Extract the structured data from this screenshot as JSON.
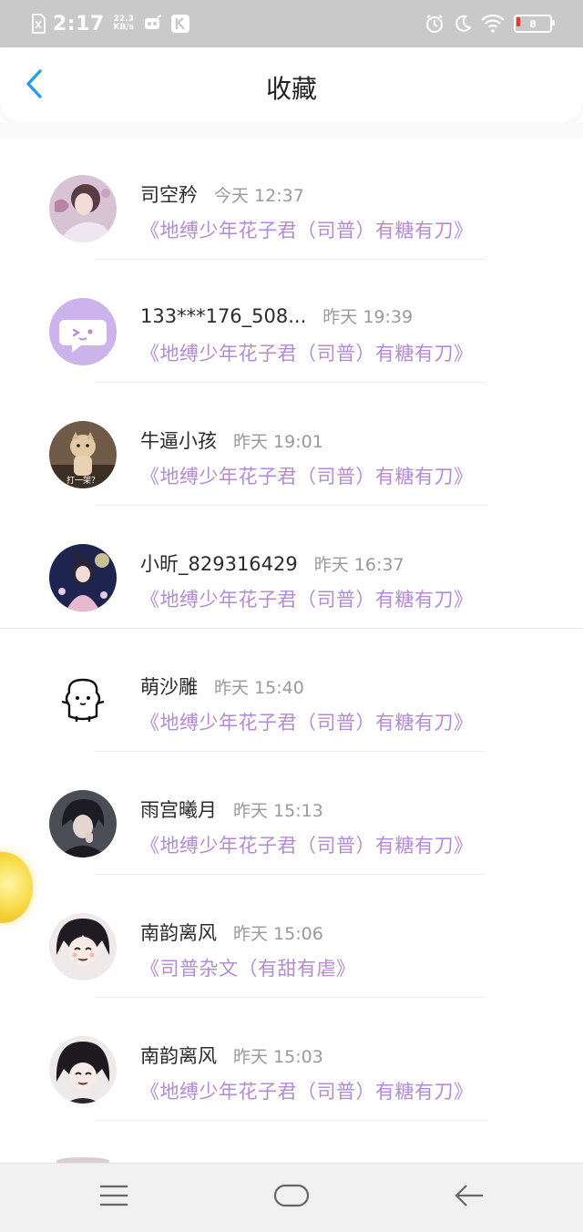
{
  "status_bar": {
    "time": "2:17",
    "speed_value": "22.3",
    "speed_unit": "KB/s",
    "battery_level": "8",
    "icons": [
      "sim-off-icon",
      "kk-app-icon",
      "k-app-icon",
      "alarm-icon",
      "moon-icon",
      "wifi-icon",
      "battery-icon"
    ]
  },
  "header": {
    "title": "收藏",
    "back_icon": "chevron-left-icon"
  },
  "accent_color": "#b58ad4",
  "favorites": [
    {
      "name": "司空矜",
      "time": "今天 12:37",
      "title": "《地缚少年花子君（司普）有糖有刀》"
    },
    {
      "name": "133***176_508...",
      "time": "昨天 19:39",
      "title": "《地缚少年花子君（司普）有糖有刀》"
    },
    {
      "name": "牛逼小孩",
      "time": "昨天 19:01",
      "title": "《地缚少年花子君（司普）有糖有刀》",
      "avatar_caption": "打一架？"
    },
    {
      "name": "小昕_829316429",
      "time": "昨天 16:37",
      "title": "《地缚少年花子君（司普）有糖有刀》"
    },
    {
      "name": "萌沙雕",
      "time": "昨天 15:40",
      "title": "《地缚少年花子君（司普）有糖有刀》"
    },
    {
      "name": "雨宫曦月",
      "time": "昨天 15:13",
      "title": "《地缚少年花子君（司普）有糖有刀》"
    },
    {
      "name": "南韵离风",
      "time": "昨天 15:06",
      "title": "《司普杂文（有甜有虐》"
    },
    {
      "name": "南韵离风",
      "time": "昨天 15:03",
      "title": "《地缚少年花子君（司普）有糖有刀》"
    }
  ],
  "nav_bar": {
    "buttons": [
      "menu-icon",
      "home-icon",
      "back-arrow-icon"
    ]
  }
}
